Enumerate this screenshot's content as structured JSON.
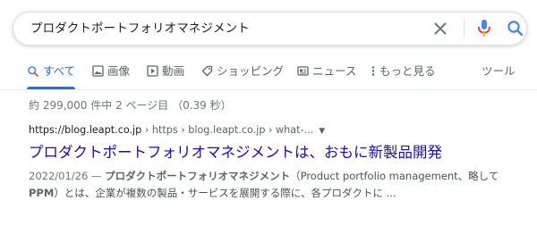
{
  "search": {
    "query": "プロダクトポートフォリオマネジメント"
  },
  "tabs": [
    {
      "label": "すべて",
      "icon": "search-icon"
    },
    {
      "label": "画像",
      "icon": "image-icon"
    },
    {
      "label": "動画",
      "icon": "video-icon"
    },
    {
      "label": "ショッピング",
      "icon": "tag-icon"
    },
    {
      "label": "ニュース",
      "icon": "news-icon"
    },
    {
      "label": "もっと見る",
      "icon": "more-vertical-icon"
    },
    {
      "label": "ツール"
    }
  ],
  "stats": "約 299,000 件中 2 ページ目 （0.39 秒）",
  "result": {
    "cite_domain": "https://blog.leapt.co.jp",
    "cite_path": " › https › blog.leapt.co.jp › what-...",
    "cite_menu_arrow": "▼",
    "title": "プロダクトポートフォリオマネジメントは、おもに新製品開発",
    "snippet_date": "2022/01/26 — ",
    "snippet_bold1": "プロダクトポートフォリオマネジメント",
    "snippet_text1": "（Product portfolio management、略して",
    "snippet_bold2": "PPM",
    "snippet_text2": "）とは、企業が複数の製品・サービスを展開する際に、各プロダクトに ..."
  },
  "colors": {
    "accent": "#1a73e8",
    "link": "#1a0dab",
    "mic_blue": "#4285f4",
    "mic_red": "#ea4335"
  }
}
